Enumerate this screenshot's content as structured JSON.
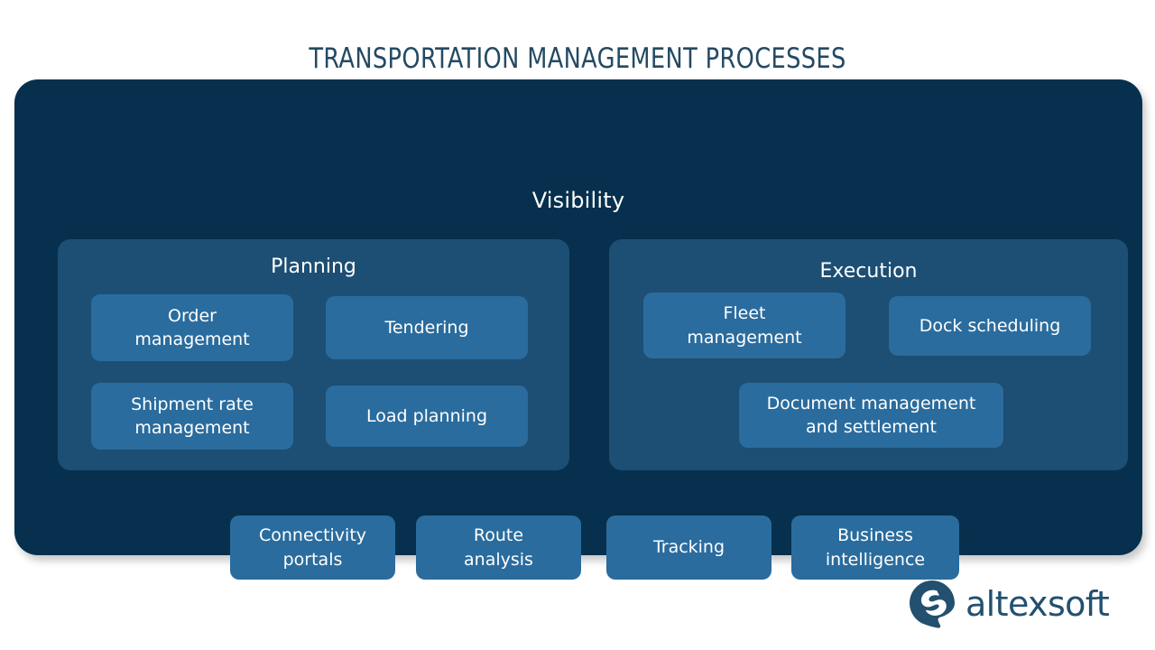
{
  "title": "TRANSPORTATION MANAGEMENT PROCESSES",
  "colors": {
    "title_text": "#244a63",
    "container_bg": "#06304d",
    "panel_bg": "#1d4e73",
    "box_bg": "#2a6c9e",
    "box_text": "#ffffff",
    "logo": "#23506f",
    "page_bg": "#ffffff"
  },
  "diagram": {
    "container_label": "Visibility",
    "groups": [
      {
        "id": "planning",
        "title": "Planning",
        "boxes": [
          {
            "id": "order-management",
            "label": "Order\nmanagement"
          },
          {
            "id": "tendering",
            "label": "Tendering"
          },
          {
            "id": "shipment-rate-management",
            "label": "Shipment rate\nmanagement"
          },
          {
            "id": "load-planning",
            "label": "Load planning"
          }
        ]
      },
      {
        "id": "execution",
        "title": "Execution",
        "boxes": [
          {
            "id": "fleet-management",
            "label": "Fleet\nmanagement"
          },
          {
            "id": "dock-scheduling",
            "label": "Dock scheduling"
          },
          {
            "id": "document-management-and-settlement",
            "label": "Document management\nand settlement"
          }
        ]
      }
    ],
    "bottom_boxes": [
      {
        "id": "connectivity-portals",
        "label": "Connectivity\nportals"
      },
      {
        "id": "route-analysis",
        "label": "Route\nanalysis"
      },
      {
        "id": "tracking",
        "label": "Tracking"
      },
      {
        "id": "business-intelligence",
        "label": "Business\nintelligence"
      }
    ]
  },
  "logo": {
    "wordmark": "altexsoft",
    "mark_icon": "altexsoft-speech-bubble-s-icon"
  }
}
